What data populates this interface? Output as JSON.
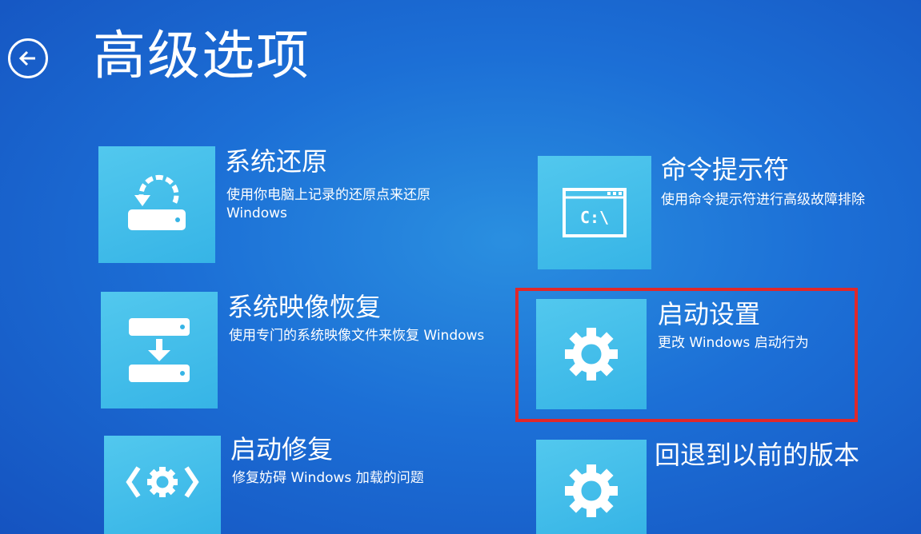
{
  "header": {
    "title": "高级选项",
    "back_icon": "back-arrow-circle-icon"
  },
  "options": [
    {
      "id": "system-restore",
      "title": "系统还原",
      "desc": "使用你电脑上记录的还原点来还原 Windows",
      "icon": "restore-drive-icon"
    },
    {
      "id": "system-image-recovery",
      "title": "系统映像恢复",
      "desc": "使用专门的系统映像文件来恢复 Windows",
      "icon": "image-recovery-icon"
    },
    {
      "id": "startup-repair",
      "title": "启动修复",
      "desc": "修复妨碍 Windows 加载的问题",
      "icon": "startup-repair-icon"
    },
    {
      "id": "command-prompt",
      "title": "命令提示符",
      "desc": "使用命令提示符进行高级故障排除",
      "icon": "command-prompt-icon",
      "icon_text": "C:\\"
    },
    {
      "id": "startup-settings",
      "title": "启动设置",
      "desc": "更改 Windows 启动行为",
      "icon": "gear-icon"
    },
    {
      "id": "go-back",
      "title": "回退到以前的版本",
      "desc": "",
      "icon": "gear-icon"
    }
  ],
  "colors": {
    "background": "#1c6fd6",
    "tile": "#3db8e8",
    "highlight": "#e0282a"
  }
}
